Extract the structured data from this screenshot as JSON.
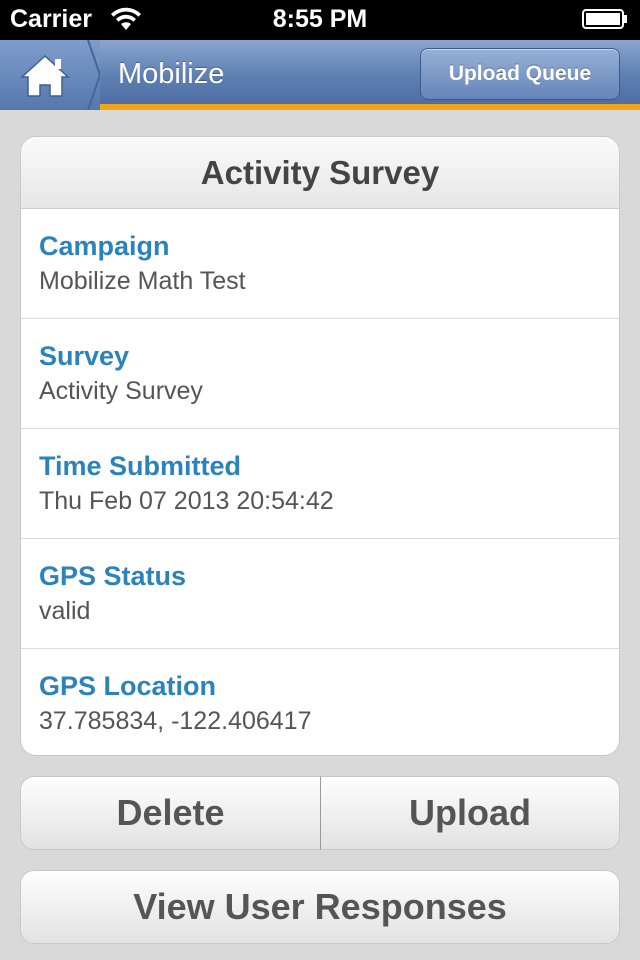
{
  "status_bar": {
    "carrier": "Carrier",
    "time": "8:55 PM"
  },
  "nav": {
    "title": "Mobilize",
    "upload_queue_label": "Upload Queue",
    "colors": {
      "bar": "#5f80b3",
      "accent_stripe": "#f2a516"
    }
  },
  "card": {
    "title": "Activity Survey",
    "rows": [
      {
        "label": "Campaign",
        "value": "Mobilize Math Test"
      },
      {
        "label": "Survey",
        "value": "Activity Survey"
      },
      {
        "label": "Time Submitted",
        "value": "Thu Feb 07 2013 20:54:42"
      },
      {
        "label": "GPS Status",
        "value": "valid"
      },
      {
        "label": "GPS Location",
        "value": "37.785834, -122.406417"
      }
    ],
    "colors": {
      "label": "#2b83bd",
      "value": "#555555"
    }
  },
  "actions": {
    "delete_label": "Delete",
    "upload_label": "Upload",
    "view_responses_label": "View User Responses"
  }
}
